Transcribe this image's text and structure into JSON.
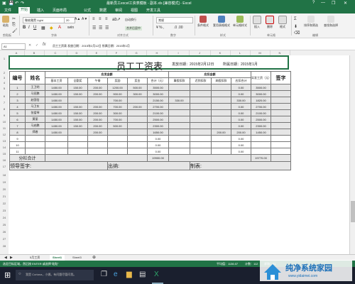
{
  "window": {
    "title": "最新员工excel工资表模板 - 副本.xls [兼容模式] - Excel",
    "controls": [
      "?",
      "—",
      "❐",
      "✕"
    ]
  },
  "ribbon_tabs": [
    "文件",
    "开始",
    "插入",
    "页面布局",
    "公式",
    "数据",
    "审阅",
    "视图",
    "开发工具"
  ],
  "ribbon": {
    "font_name": "微软雅黑 Light",
    "font_size": "20",
    "wrap_label": "自动换行",
    "merge_label": "合并后居中",
    "number_format": "常规",
    "buttons": {
      "paste": "粘贴",
      "cond_format": "条件格式",
      "table_format": "套用表格格式",
      "cell_style": "单元格样式",
      "insert": "插入",
      "delete": "删除",
      "format": "格式",
      "sort_filter": "排序和筛选",
      "find_select": "查找和选择"
    },
    "groups": [
      "剪贴板",
      "字体",
      "对齐方式",
      "数字",
      "样式",
      "单元格",
      "编辑"
    ]
  },
  "formula_bar": {
    "name_box": "A1",
    "content": "员工工资表    发放日期：2015年2月12日  所属日期：2015年1月"
  },
  "columns": [
    "A",
    "B",
    "C",
    "D",
    "E",
    "F",
    "G",
    "H",
    "I",
    "J",
    "K",
    "L",
    "M",
    "N"
  ],
  "rows": [
    "1",
    "2",
    "3",
    "4",
    "5",
    "6",
    "7",
    "8",
    "9",
    "10",
    "11",
    "12",
    "13",
    "14",
    "15",
    "16",
    "17",
    "18",
    "19",
    "20",
    "21",
    "22",
    "23",
    "24",
    "25",
    "26",
    "27",
    "28"
  ],
  "sheet": {
    "title": "员工工资表",
    "issue_date": "发放日期：2015年2月12日",
    "period": "所属日期：2015年1月",
    "headers": {
      "no": "编号",
      "name": "姓名",
      "payable_group": "应发金额",
      "deduct_group": "应扣金额",
      "base": "基本工资",
      "full_attend": "全勤奖",
      "lunch": "午餐",
      "bonus": "奖励",
      "reward": "奖金",
      "total": "合计（元）",
      "late": "事假扣款",
      "absent": "迟到扣款",
      "sick": "病假扣款",
      "other": "其他扣款",
      "deduct_total": "应扣合计",
      "net": "实发工资（元）",
      "sign": "签字"
    },
    "employees": [
      {
        "no": "1",
        "name": "王卫明",
        "base": "1450.00",
        "full": "150.00",
        "lunch": "200.00",
        "bonus": "1200.00",
        "reward": "500.00",
        "total": "3500.00",
        "late": "",
        "absent": "",
        "sick": "",
        "other": "",
        "dtotal": "0.00",
        "net": "3500.00"
      },
      {
        "no": "2",
        "name": "马亚鹏",
        "base": "1450.00",
        "full": "150.00",
        "lunch": "200.00",
        "bonus": "900.00",
        "reward": "300.00",
        "total": "3000.00",
        "late": "",
        "absent": "",
        "sick": "",
        "other": "",
        "dtotal": "0.00",
        "net": "3000.00"
      },
      {
        "no": "3",
        "name": "赵国信",
        "base": "1450.00",
        "full": "",
        "lunch": "",
        "bonus": "700.00",
        "reward": "",
        "total": "2150.00",
        "late": "330.00",
        "absent": "",
        "sick": "",
        "other": "",
        "dtotal": "330.00",
        "net": "1820.00"
      },
      {
        "no": "4",
        "name": "马卫东",
        "base": "1450.00",
        "full": "150.00",
        "lunch": "200.00",
        "bonus": "700.00",
        "reward": "200.00",
        "total": "2700.00",
        "late": "",
        "absent": "",
        "sick": "",
        "other": "",
        "dtotal": "0.00",
        "net": "2700.00"
      },
      {
        "no": "5",
        "name": "张爱琴",
        "base": "1450.00",
        "full": "150.00",
        "lunch": "200.00",
        "bonus": "300.00",
        "reward": "",
        "total": "2100.00",
        "late": "",
        "absent": "",
        "sick": "",
        "other": "",
        "dtotal": "0.00",
        "net": "2100.00"
      },
      {
        "no": "6",
        "name": "黄丽",
        "base": "1450.00",
        "full": "150.00",
        "lunch": "200.00",
        "bonus": "700.00",
        "reward": "",
        "total": "2500.00",
        "late": "",
        "absent": "",
        "sick": "",
        "other": "",
        "dtotal": "0.00",
        "net": "2500.00"
      },
      {
        "no": "7",
        "name": "马启鹏",
        "base": "1450.00",
        "full": "150.00",
        "lunch": "200.00",
        "bonus": "500.00",
        "reward": "",
        "total": "2300.00",
        "late": "",
        "absent": "",
        "sick": "",
        "other": "",
        "dtotal": "0.00",
        "net": "2300.00"
      },
      {
        "no": "8",
        "name": "郑睿",
        "base": "1450.00",
        "full": "",
        "lunch": "200.00",
        "bonus": "",
        "reward": "",
        "total": "1650.00",
        "late": "",
        "absent": "",
        "sick": "200.00",
        "other": "",
        "dtotal": "200.00",
        "net": "1450.00"
      },
      {
        "no": "9",
        "name": "",
        "base": "",
        "full": "",
        "lunch": "",
        "bonus": "",
        "reward": "",
        "total": "0.00",
        "late": "",
        "absent": "",
        "sick": "",
        "other": "",
        "dtotal": "0.00",
        "net": ""
      },
      {
        "no": "10",
        "name": "",
        "base": "",
        "full": "",
        "lunch": "",
        "bonus": "",
        "reward": "",
        "total": "0.00",
        "late": "",
        "absent": "",
        "sick": "",
        "other": "",
        "dtotal": "0.00",
        "net": ""
      },
      {
        "no": "11",
        "name": "",
        "base": "",
        "full": "",
        "lunch": "",
        "bonus": "",
        "reward": "",
        "total": "0.00",
        "late": "",
        "absent": "",
        "sick": "",
        "other": "",
        "dtotal": "0.00",
        "net": ""
      }
    ],
    "subtotal_label": "分栏合计",
    "subtotal_total": "19900.00",
    "subtotal_net": "19770.00",
    "footer": {
      "leader": "领导签字:",
      "cashier": "出纳:",
      "preparer": "制表:"
    }
  },
  "sheet_tabs": [
    "5月工资",
    "Sheet1",
    "Sheet3"
  ],
  "status": {
    "message": "选定目标区域，然后按 ENTER 或选择\"粘贴\"",
    "average": "平均值：1136.07",
    "count": "计数：112",
    "sum": "求和：51"
  },
  "taskbar": {
    "search": "我是 Cortana，小娜。有问题尽管问我。"
  },
  "watermark": {
    "title": "纯净系统家园",
    "url": "www.yidaimei.com"
  },
  "colors": {
    "excel_green": "#217346",
    "taskbar": "#1a1f2e",
    "grid_fill": "#e6e6e6"
  }
}
